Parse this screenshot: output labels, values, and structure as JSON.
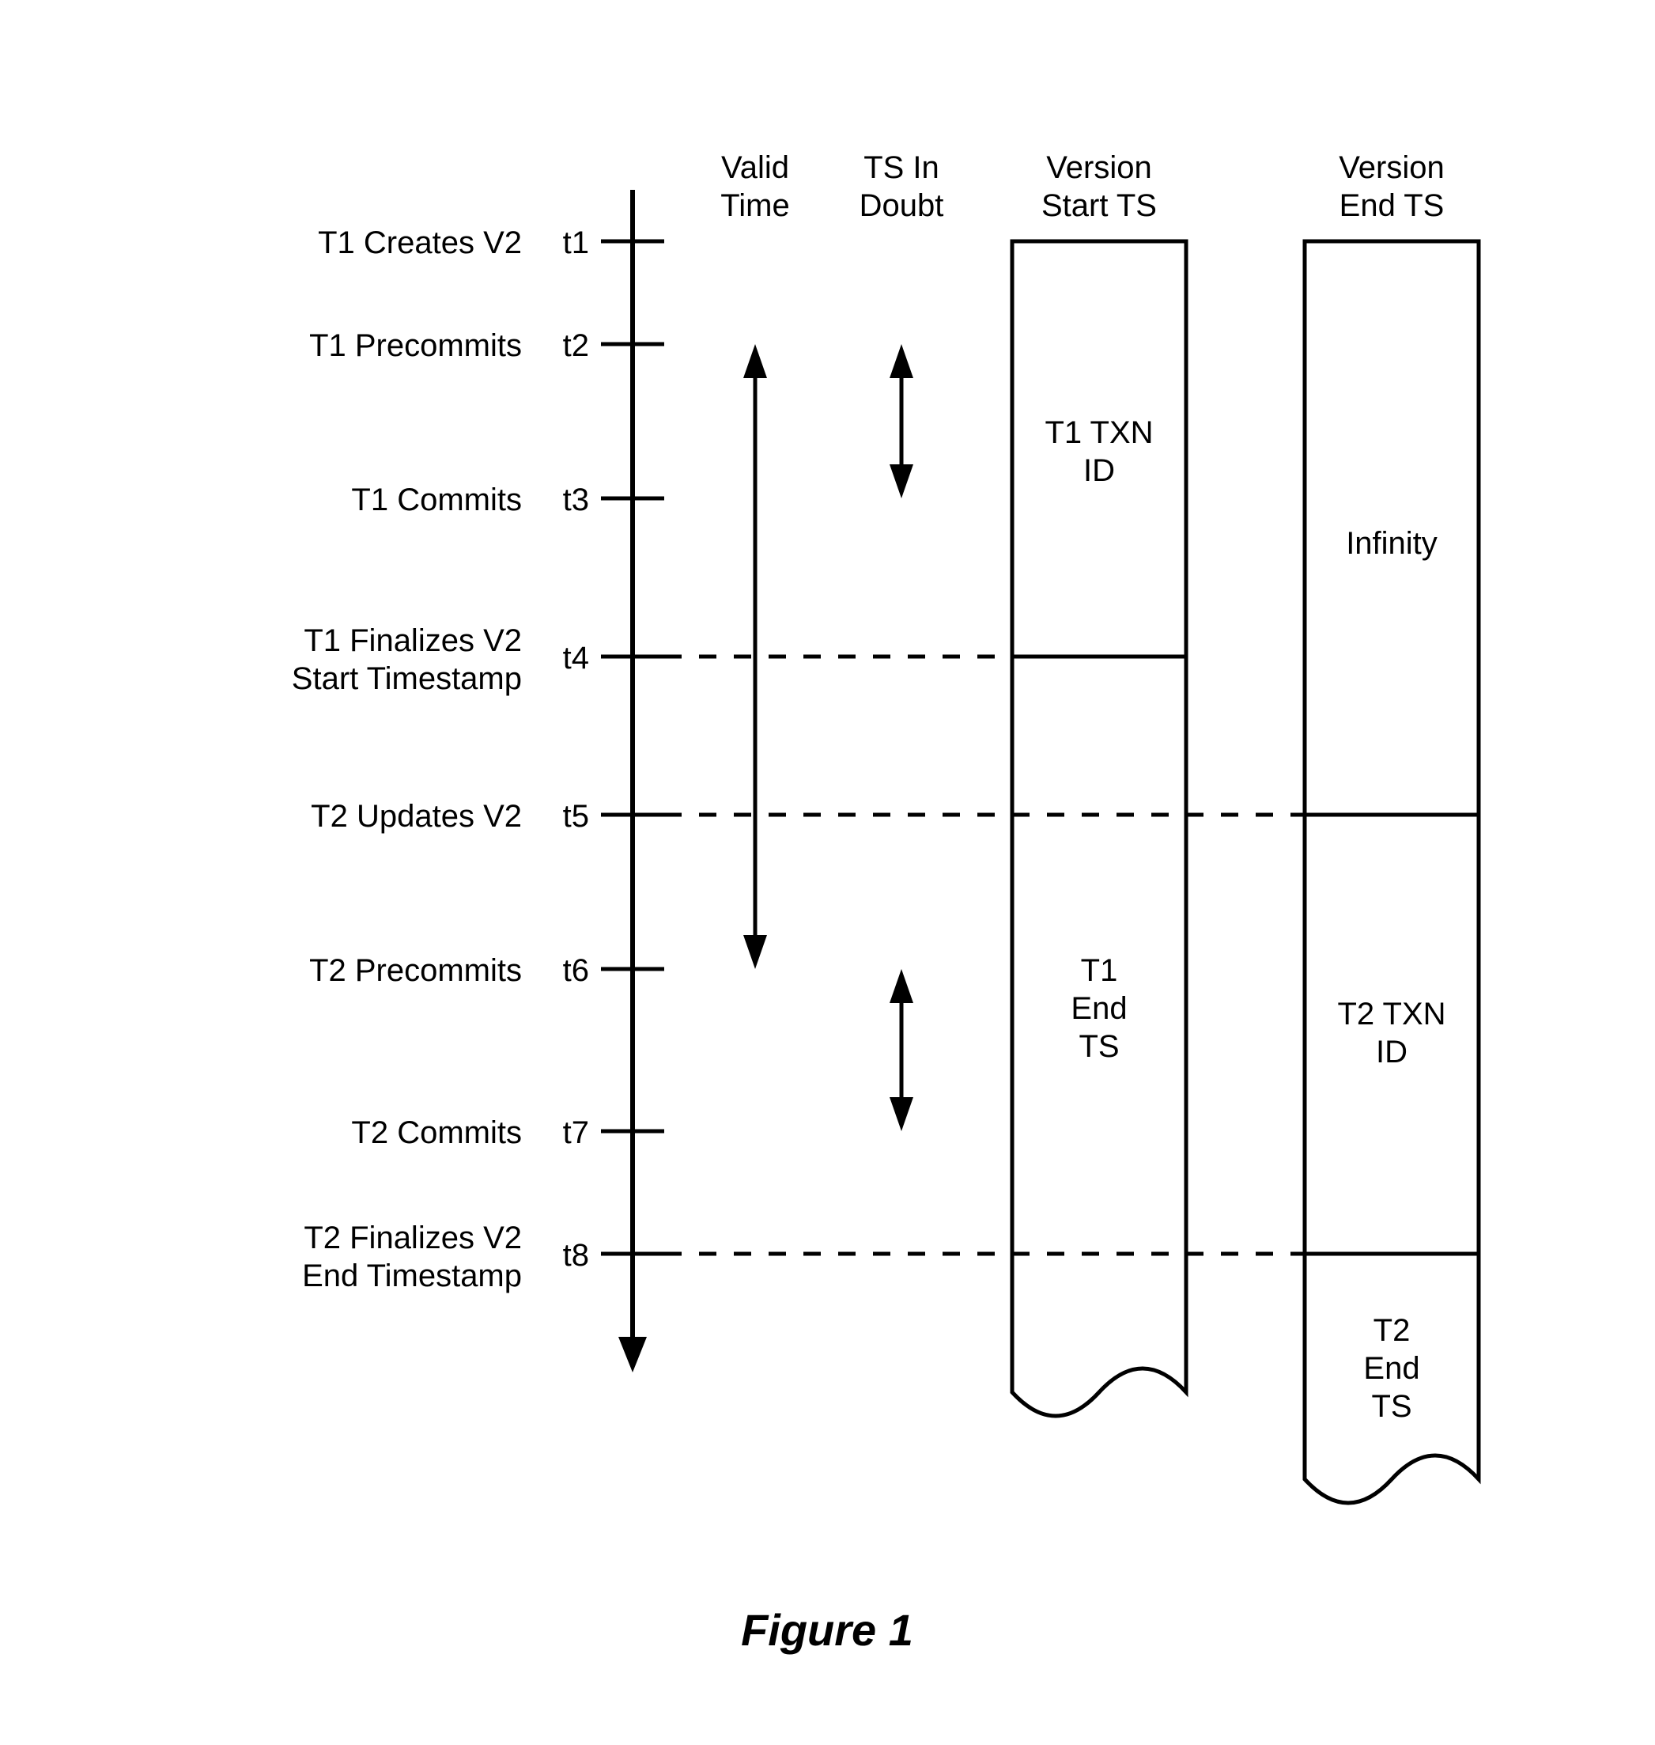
{
  "headers": {
    "valid1": "Valid",
    "valid2": "Time",
    "doubt1": "TS In",
    "doubt2": "Doubt",
    "vstart1": "Version",
    "vstart2": "Start TS",
    "vend1": "Version",
    "vend2": "End TS"
  },
  "events": {
    "e1": "T1 Creates V2",
    "e2": "T1 Precommits",
    "e3": "T1 Commits",
    "e4a": "T1 Finalizes V2",
    "e4b": "Start Timestamp",
    "e5": "T2 Updates V2",
    "e6": "T2 Precommits",
    "e7": "T2 Commits",
    "e8a": "T2 Finalizes V2",
    "e8b": "End Timestamp"
  },
  "ticks": {
    "t1": "t1",
    "t2": "t2",
    "t3": "t3",
    "t4": "t4",
    "t5": "t5",
    "t6": "t6",
    "t7": "t7",
    "t8": "t8"
  },
  "start_col": {
    "seg1a": "T1 TXN",
    "seg1b": "ID",
    "seg2a": "T1",
    "seg2b": "End",
    "seg2c": "TS"
  },
  "end_col": {
    "seg1": "Infinity",
    "seg2a": "T2 TXN",
    "seg2b": "ID",
    "seg3a": "T2",
    "seg3b": "End",
    "seg3c": "TS"
  },
  "caption": "Figure 1",
  "chart_data": {
    "type": "table",
    "time_points": [
      "t1",
      "t2",
      "t3",
      "t4",
      "t5",
      "t6",
      "t7",
      "t8"
    ],
    "events": [
      "T1 Creates V2",
      "T1 Precommits",
      "T1 Commits",
      "T1 Finalizes V2 Start Timestamp",
      "T2 Updates V2",
      "T2 Precommits",
      "T2 Commits",
      "T2 Finalizes V2 End Timestamp"
    ],
    "valid_time_range": [
      "t2",
      "t6"
    ],
    "ts_in_doubt_ranges": [
      [
        "t2",
        "t3"
      ],
      [
        "t6",
        "t7"
      ]
    ],
    "version_start_ts": [
      {
        "from": "t1",
        "to": "t4",
        "value": "T1 TXN ID"
      },
      {
        "from": "t4",
        "to": "end",
        "value": "T1 End TS"
      }
    ],
    "version_end_ts": [
      {
        "from": "t1",
        "to": "t5",
        "value": "Infinity"
      },
      {
        "from": "t5",
        "to": "t8",
        "value": "T2 TXN ID"
      },
      {
        "from": "t8",
        "to": "end",
        "value": "T2 End TS"
      }
    ]
  }
}
